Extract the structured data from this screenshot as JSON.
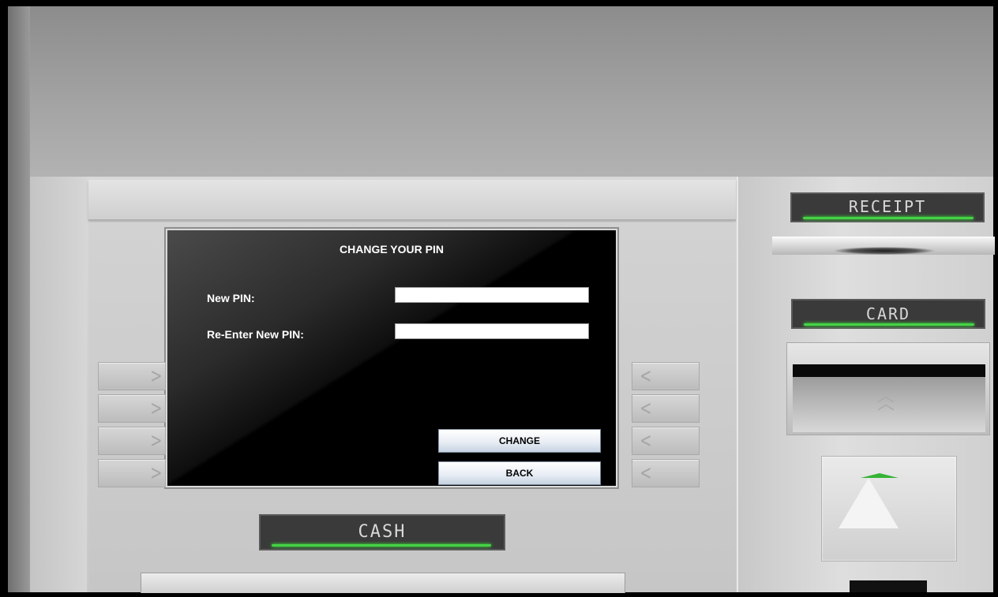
{
  "screen": {
    "title": "CHANGE YOUR PIN",
    "new_pin_label": "New PIN:",
    "reenter_pin_label": "Re-Enter New PIN:",
    "new_pin_value": "",
    "reenter_pin_value": "",
    "change_button": "CHANGE",
    "back_button": "BACK"
  },
  "signs": {
    "receipt": "RECEIPT",
    "card": "CARD",
    "cash": "CASH"
  },
  "colors": {
    "led_green": "#46d246",
    "screen_bg": "#000000",
    "button_blue": "#c6d3e2"
  }
}
